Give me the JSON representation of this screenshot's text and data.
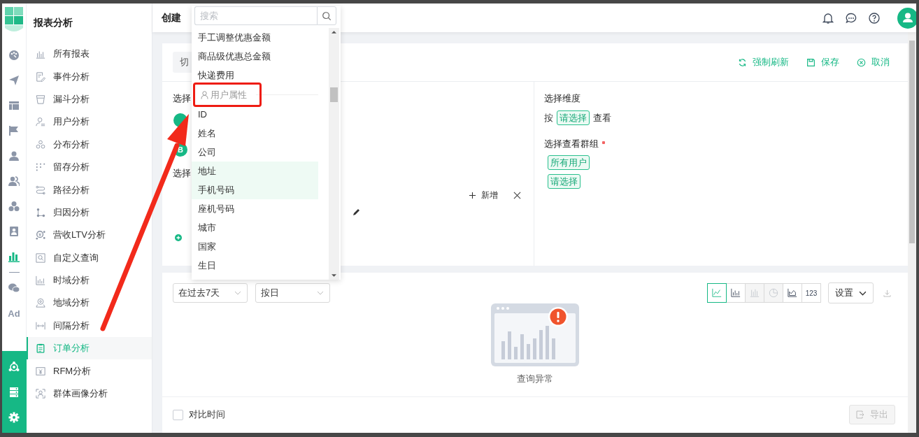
{
  "rail": {
    "items": [
      {
        "kind": "icon",
        "selected": false
      },
      {
        "kind": "icon",
        "selected": false
      },
      {
        "kind": "icon",
        "selected": false
      },
      {
        "kind": "icon",
        "selected": false
      },
      {
        "kind": "icon",
        "selected": false
      },
      {
        "kind": "icon",
        "selected": false
      },
      {
        "kind": "icon",
        "selected": false
      },
      {
        "kind": "icon",
        "selected": false
      },
      {
        "kind": "icon",
        "selected": true
      },
      {
        "kind": "icon",
        "selected": false
      },
      {
        "kind": "text",
        "label": "Ad",
        "selected": false
      }
    ]
  },
  "sidebar": {
    "title": "报表分析",
    "items": [
      {
        "label": "所有报表",
        "selected": false
      },
      {
        "label": "事件分析",
        "selected": false
      },
      {
        "label": "漏斗分析",
        "selected": false
      },
      {
        "label": "用户分析",
        "selected": false
      },
      {
        "label": "分布分析",
        "selected": false
      },
      {
        "label": "留存分析",
        "selected": false
      },
      {
        "label": "路径分析",
        "selected": false
      },
      {
        "label": "归因分析",
        "selected": false
      },
      {
        "label": "营收LTV分析",
        "selected": false
      },
      {
        "label": "自定义查询",
        "selected": false
      },
      {
        "label": "时域分析",
        "selected": false
      },
      {
        "label": "地域分析",
        "selected": false
      },
      {
        "label": "间隔分析",
        "selected": false
      },
      {
        "label": "订单分析",
        "selected": true
      },
      {
        "label": "RFM分析",
        "selected": false
      },
      {
        "label": "群体画像分析",
        "selected": false
      }
    ]
  },
  "topbar": {
    "title": "创建"
  },
  "query_card": {
    "switch_button": "切",
    "actions": [
      {
        "label": "强制刷新"
      },
      {
        "label": "保存"
      },
      {
        "label": "取消"
      }
    ],
    "metrics_title": "选择",
    "badges": [
      {
        "kind": "hidden"
      },
      {
        "kind": "letter",
        "label": "B"
      }
    ],
    "filter_title": "选择",
    "add_label": "新增",
    "dimension_title": "选择维度",
    "dimension_prefix": "按",
    "dimension_select": "请选择",
    "dimension_suffix": "查看",
    "group_title": "选择查看群组",
    "group_required": true,
    "group_tags": [
      "所有用户",
      "请选择"
    ]
  },
  "result_card": {
    "selects": [
      "在过去7天",
      "按日"
    ],
    "chart_types": [
      {
        "kind": "line",
        "selected": true,
        "disabled": false
      },
      {
        "kind": "bar",
        "selected": false,
        "disabled": false
      },
      {
        "kind": "stacked",
        "selected": false,
        "disabled": true
      },
      {
        "kind": "pie",
        "selected": false,
        "disabled": true
      },
      {
        "kind": "area",
        "selected": false,
        "disabled": false
      },
      {
        "kind": "number",
        "label": "123",
        "selected": false,
        "disabled": false
      }
    ],
    "settings": "设置",
    "empty_text": "查询异常",
    "compare": {
      "label": "对比时间",
      "checked": false
    },
    "export": {
      "label": "导出",
      "disabled": true
    }
  },
  "dropdown": {
    "placeholder": "搜索",
    "items": [
      {
        "kind": "option",
        "label": "手工调整优惠金额",
        "highlighted": false
      },
      {
        "kind": "option",
        "label": "商品级优惠总金额",
        "highlighted": false
      },
      {
        "kind": "option",
        "label": "快递费用",
        "highlighted": false
      },
      {
        "kind": "group",
        "label": "用户属性",
        "highlighted": false
      },
      {
        "kind": "option",
        "label": "ID",
        "highlighted": false
      },
      {
        "kind": "option",
        "label": "姓名",
        "highlighted": false
      },
      {
        "kind": "option",
        "label": "公司",
        "highlighted": false
      },
      {
        "kind": "option",
        "label": "地址",
        "highlighted": true
      },
      {
        "kind": "option",
        "label": "手机号码",
        "highlighted": true
      },
      {
        "kind": "option",
        "label": "座机号码",
        "highlighted": false
      },
      {
        "kind": "option",
        "label": "城市",
        "highlighted": false
      },
      {
        "kind": "option",
        "label": "国家",
        "highlighted": false
      },
      {
        "kind": "option",
        "label": "生日",
        "highlighted": false
      }
    ]
  },
  "annotations": {
    "frame": true,
    "arrow": true
  }
}
